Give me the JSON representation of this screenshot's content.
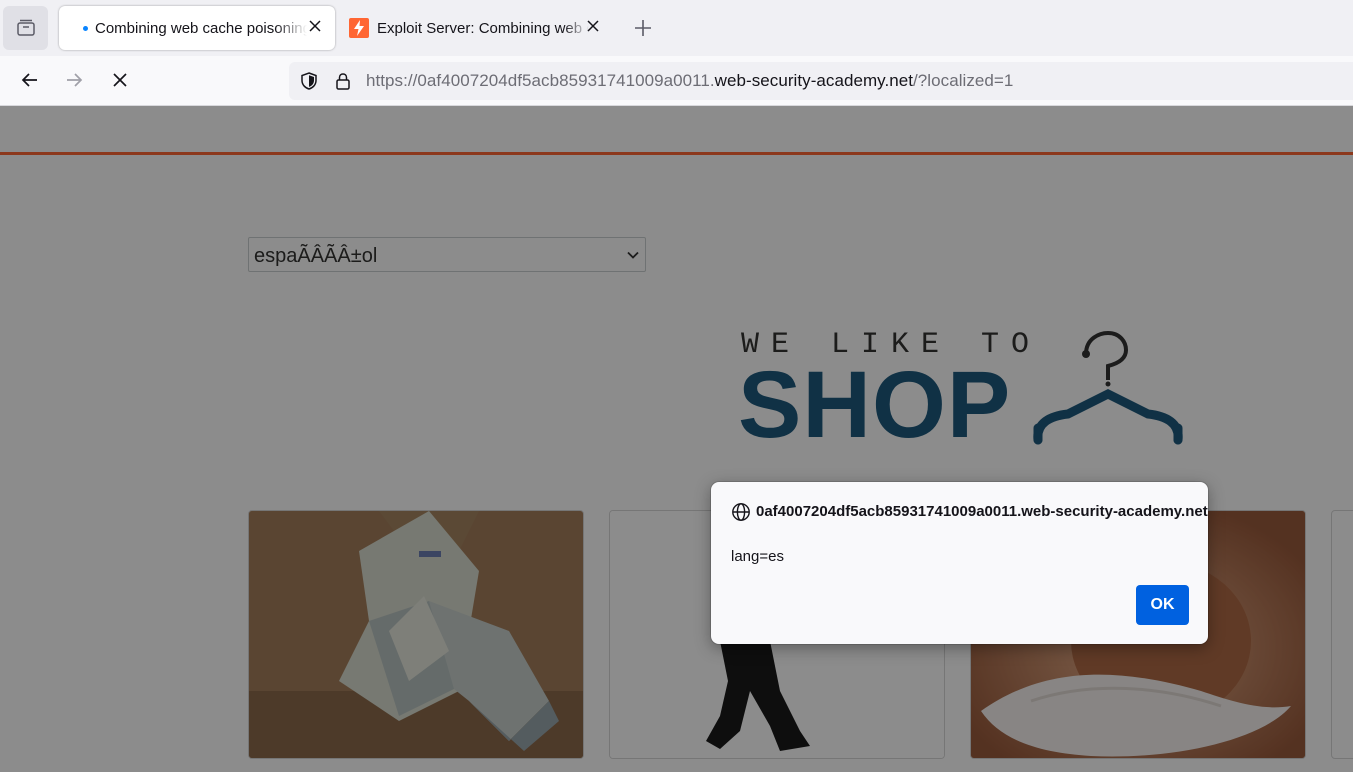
{
  "browser": {
    "tabs": [
      {
        "title": "Combining web cache poisoning vulnerabilities",
        "active": true,
        "loading": true
      },
      {
        "title": "Exploit Server: Combining web cache poisoning vulnerabilities",
        "active": false
      }
    ],
    "url": {
      "prefix": "https://0af4007204df5acb85931741009a0011.",
      "domain": "web-security-academy.net",
      "suffix": "/?localized=1"
    }
  },
  "page": {
    "language_select": {
      "selected": "espaÃÂÃÂ±ol"
    },
    "logo": {
      "top_text": "WE LIKE TO",
      "main_text": "SHOP"
    },
    "colors": {
      "header_rule": "#ff6633",
      "logo_blue": "#1e5a7e"
    }
  },
  "dialog": {
    "origin": "0af4007204df5acb85931741009a0011.web-security-academy.net",
    "message": "lang=es",
    "ok_label": "OK",
    "button_color": "#0061e0"
  }
}
